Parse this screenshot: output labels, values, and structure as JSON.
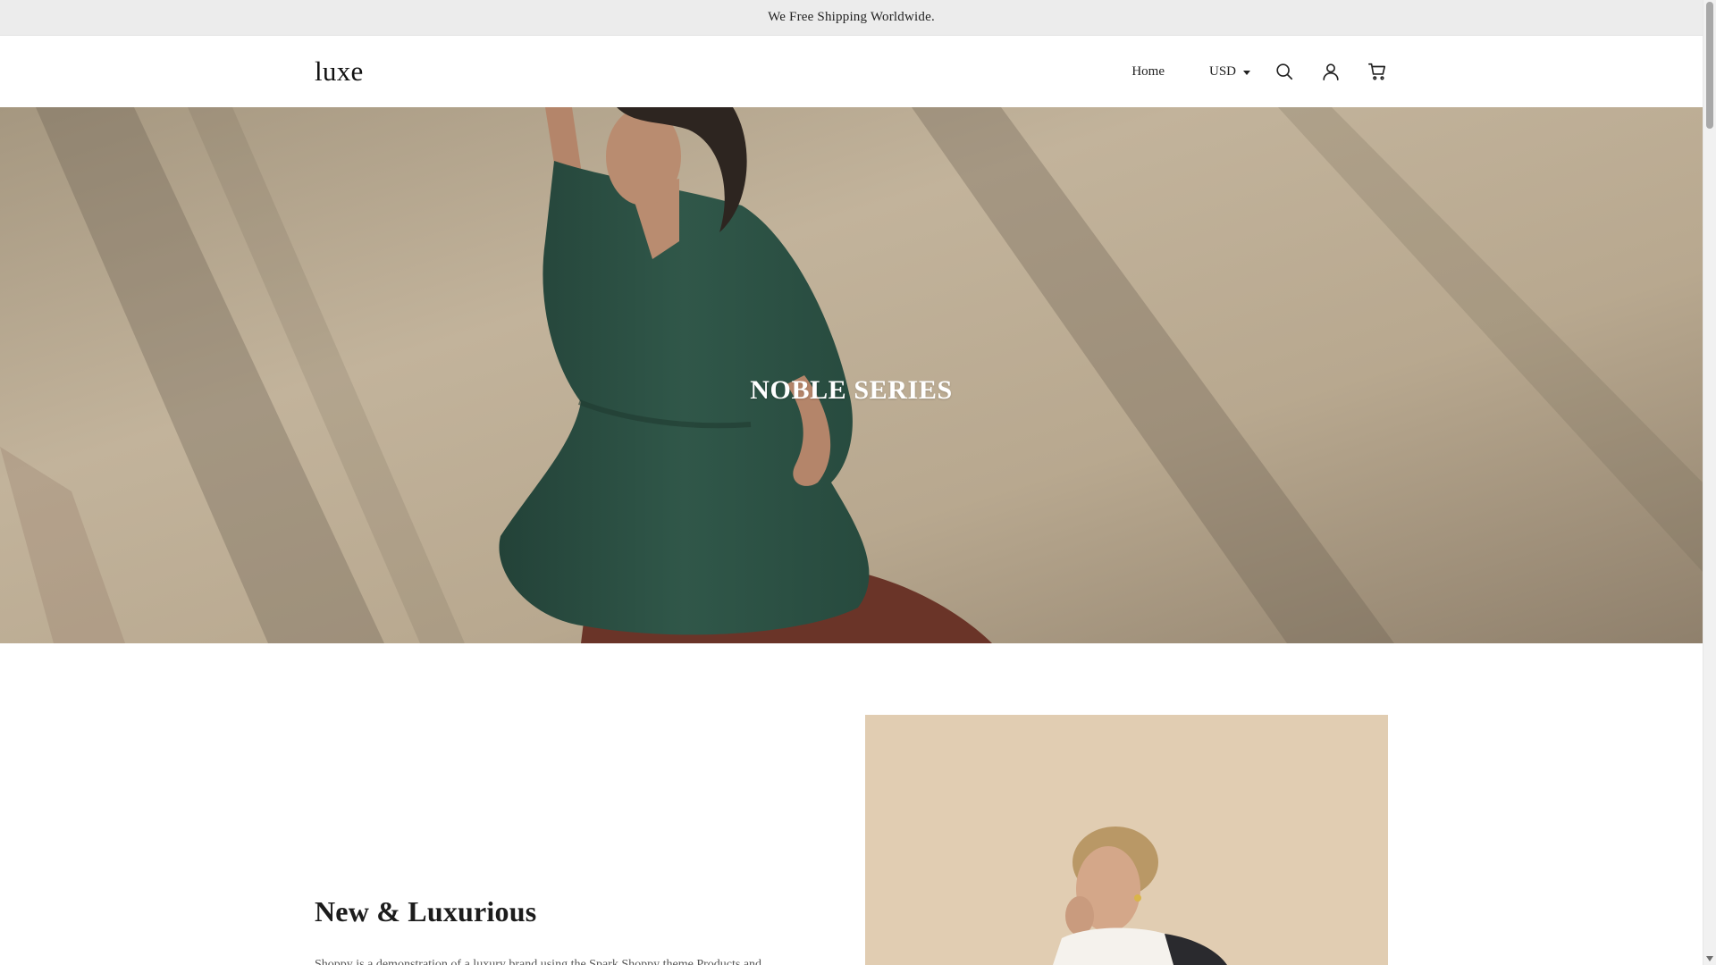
{
  "announcement": {
    "text": "We Free Shipping Worldwide."
  },
  "header": {
    "logo": "luxe",
    "nav": {
      "home": "Home"
    },
    "currency": {
      "selected": "USD"
    },
    "icons": [
      "search-icon",
      "account-icon",
      "cart-icon"
    ]
  },
  "hero": {
    "title": "NOBLE SERIES"
  },
  "feature": {
    "heading": "New & Luxurious",
    "body": "Shoppy is a demonstration of a luxury brand using the Spark Shoppy theme.Products and"
  },
  "colors": {
    "announcement_bg": "#ececec",
    "hero_bg": "#b9aa94",
    "shirt": "#2e5347",
    "skirt": "#6a3428",
    "feature_image_bg": "#dcc7ab"
  }
}
